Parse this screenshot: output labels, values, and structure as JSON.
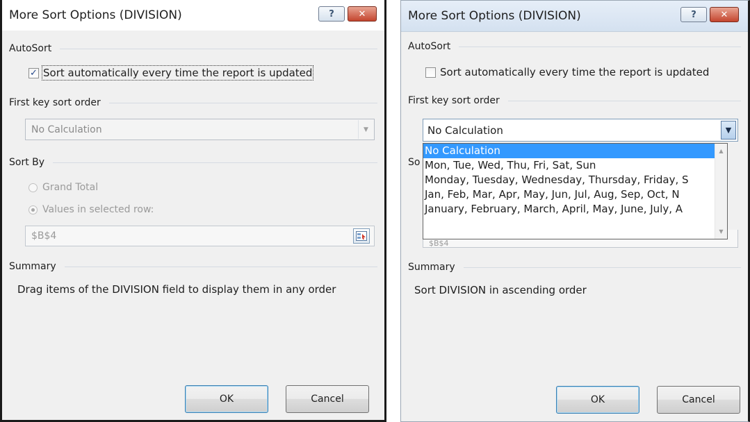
{
  "left_dialog": {
    "title": "More Sort Options (DIVISION)",
    "help_glyph": "?",
    "close_glyph": "✕",
    "autosort_header": "AutoSort",
    "autosort_checkbox_label": "Sort automatically every time the report is updated",
    "autosort_checked": true,
    "first_key_header": "First key sort order",
    "first_key_value": "No Calculation",
    "sort_by_header": "Sort By",
    "radio_grand_total": "Grand Total",
    "radio_values_row": "Values in selected row:",
    "ref_value": "$B$4",
    "summary_header": "Summary",
    "summary_text": "Drag items of the DIVISION field to display them in any order",
    "ok_label": "OK",
    "cancel_label": "Cancel"
  },
  "right_dialog": {
    "title": "More Sort Options (DIVISION)",
    "help_glyph": "?",
    "close_glyph": "✕",
    "autosort_header": "AutoSort",
    "autosort_checkbox_label": "Sort automatically every time the report is updated",
    "autosort_checked": false,
    "first_key_header": "First key sort order",
    "first_key_value": "No Calculation",
    "sort_by_header_partial": "So",
    "ref_value_partial": "$B$4",
    "dropdown_options": [
      "No Calculation",
      "Mon, Tue, Wed, Thu, Fri, Sat, Sun",
      "Monday, Tuesday, Wednesday, Thursday, Friday, S",
      "Jan, Feb, Mar, Apr, May, Jun, Jul, Aug, Sep, Oct, N",
      "January, February, March, April, May, June, July, A"
    ],
    "summary_header": "Summary",
    "summary_text": "Sort DIVISION in ascending order",
    "ok_label": "OK",
    "cancel_label": "Cancel"
  },
  "colors": {
    "dialog_bg": "#f0f0f0",
    "selection": "#3399ff",
    "close_button": "#c4452e"
  }
}
